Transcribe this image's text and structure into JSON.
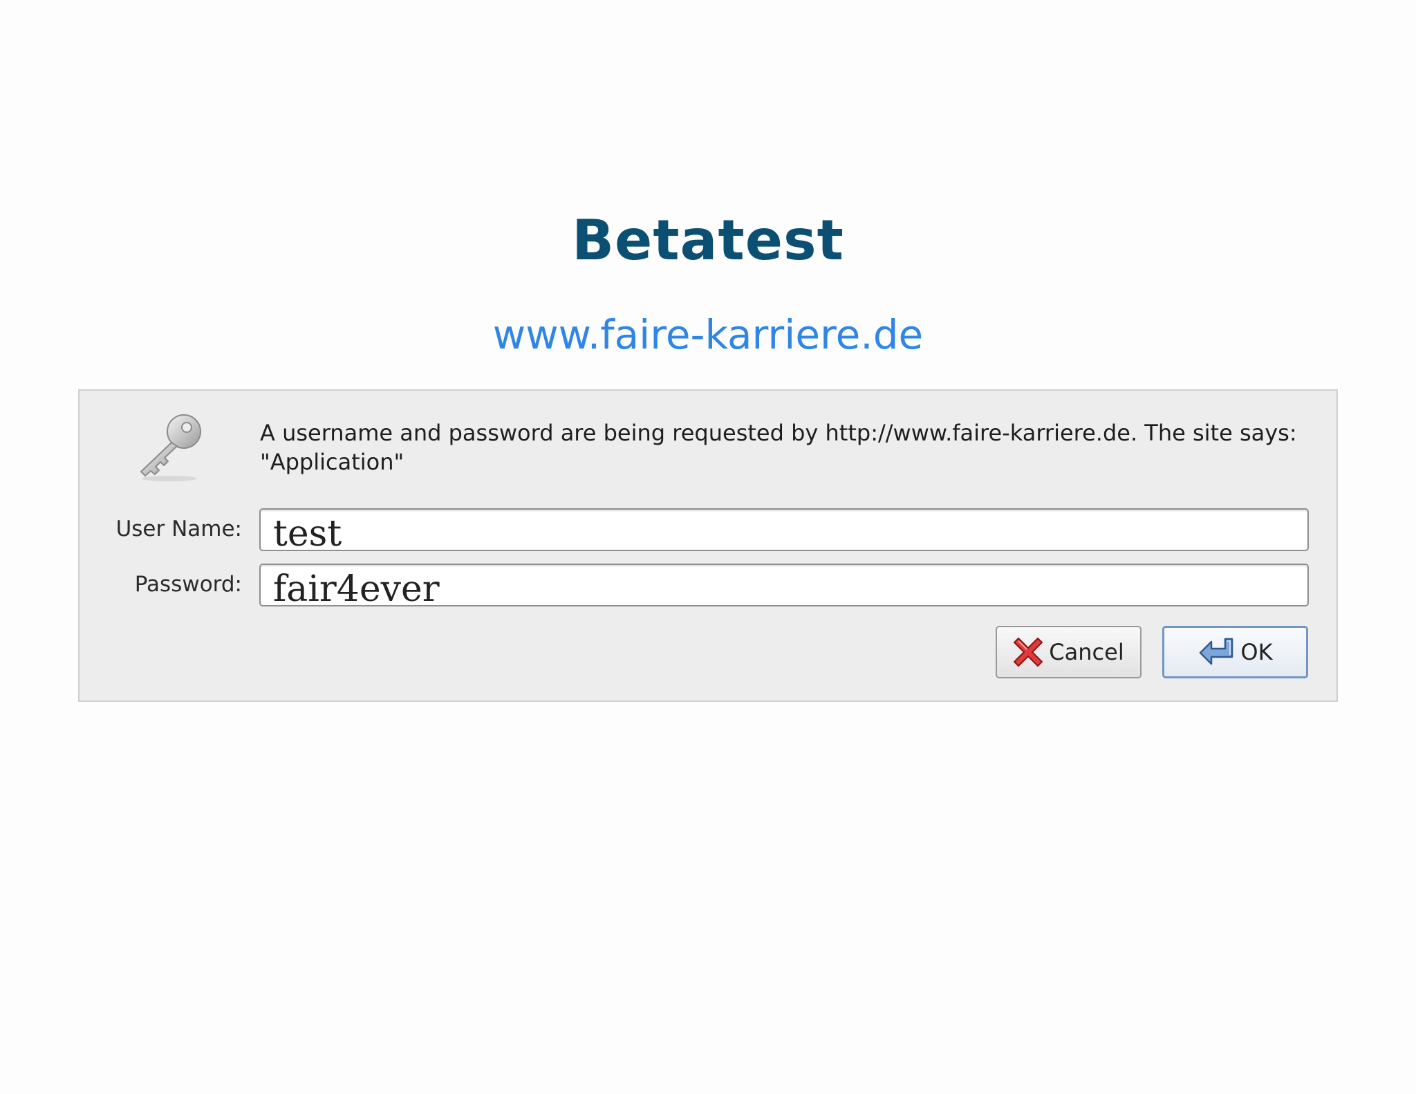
{
  "header": {
    "title": "Betatest",
    "subtitle": "www.faire-karriere.de"
  },
  "dialog": {
    "icon": "key-icon",
    "message": "A username and password are being requested by http://www.faire-karriere.de. The site says: \"Application\"",
    "username_label": "User Name:",
    "username_value": "test",
    "password_label": "Password:",
    "password_value": "fair4ever",
    "cancel_label": "Cancel",
    "cancel_icon": "cancel-x-icon",
    "ok_label": "OK",
    "ok_icon": "enter-arrow-icon"
  },
  "colors": {
    "title": "#0b4f73",
    "subtitle": "#2f86e6",
    "dialog_bg": "#ededed"
  }
}
